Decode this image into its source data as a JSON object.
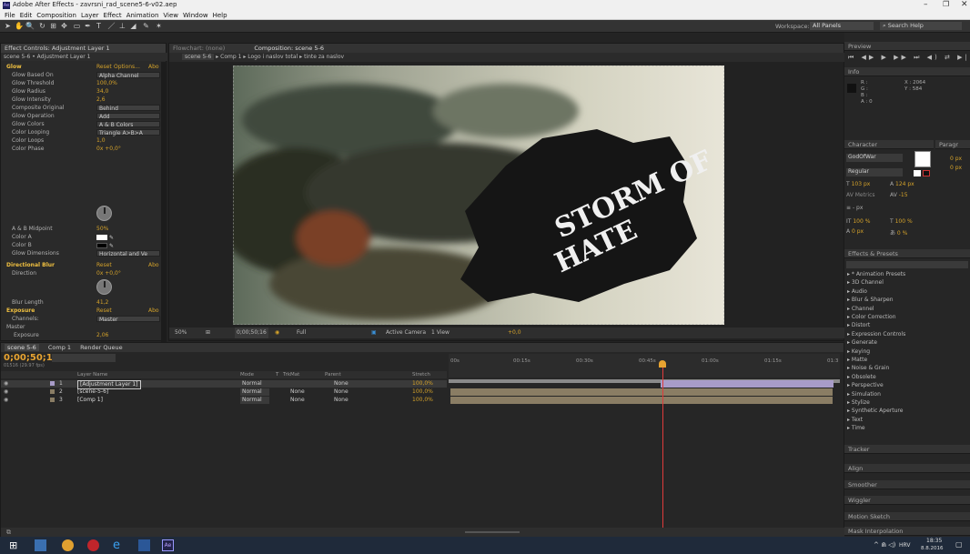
{
  "window": {
    "title": "Adobe After Effects - zavrsni_rad_scene5-6-v02.aep"
  },
  "menu": [
    "File",
    "Edit",
    "Composition",
    "Layer",
    "Effect",
    "Animation",
    "View",
    "Window",
    "Help"
  ],
  "toolbar": {
    "workspace_label": "Workspace:",
    "workspace_value": "All Panels",
    "search_placeholder": "Search Help"
  },
  "effect_controls": {
    "tab": "Effect Controls: Adjustment Layer 1",
    "breadcrumb": "scene 5-6 • Adjustment Layer 1",
    "reset": "Reset",
    "options": "Options...",
    "about": "Abo",
    "glow": {
      "name": "Glow",
      "props": [
        {
          "n": "Glow Based On",
          "dd": "Alpha Channel"
        },
        {
          "n": "Glow Threshold",
          "v": "100,0%"
        },
        {
          "n": "Glow Radius",
          "v": "34,0"
        },
        {
          "n": "Glow Intensity",
          "v": "2,6"
        },
        {
          "n": "Composite Original",
          "dd": "Behind"
        },
        {
          "n": "Glow Operation",
          "dd": "Add"
        },
        {
          "n": "Glow Colors",
          "dd": "A & B Colors"
        },
        {
          "n": "Color Looping",
          "dd": "Triangle A>B>A"
        },
        {
          "n": "Color Loops",
          "v": "1,0"
        },
        {
          "n": "Color Phase",
          "v": "0x +0,0°"
        }
      ],
      "props2": [
        {
          "n": "A & B Midpoint",
          "v": "50%"
        },
        {
          "n": "Color A",
          "v": ""
        },
        {
          "n": "Color B",
          "v": ""
        },
        {
          "n": "Glow Dimensions",
          "dd": "Horizontal and Ve"
        }
      ]
    },
    "dirblur": {
      "name": "Directional Blur",
      "props": [
        {
          "n": "Direction",
          "v": "0x +0,0°"
        },
        {
          "n": "Blur Length",
          "v": "41,2"
        }
      ]
    },
    "exposure": {
      "name": "Exposure",
      "channels_label": "Channels:",
      "channels_value": "Master",
      "master": "Master",
      "props": [
        {
          "n": "Exposure",
          "v": "2,06"
        },
        {
          "n": "Offset",
          "v": "0,0000"
        },
        {
          "n": "Gamma Correction",
          "v": "1,00"
        }
      ],
      "more": [
        "Red",
        "Green",
        "Blue"
      ]
    }
  },
  "comp_panel": {
    "tab_flowchart": "Flowchart: (none)",
    "tab_comp": "Composition: scene 5-6",
    "crumbs": [
      "scene 5-6",
      "Comp 1",
      "Logo i naslov total",
      "tinte za naslov"
    ],
    "footer": {
      "zoom": "50%",
      "time": "0;00;50;16",
      "res": "Full",
      "camera": "Active Camera",
      "view": "1 View",
      "exposure": "+0,0"
    },
    "overlay_text": [
      "STORM OF",
      "HATE"
    ]
  },
  "timeline": {
    "tabs": [
      "scene 5-6",
      "Comp 1",
      "Render Queue"
    ],
    "timecode": "0;00;50;16",
    "fps": "01516 (29.97 fps)",
    "cols": [
      "Layer Name",
      "Mode",
      "T",
      "TrkMat",
      "Parent",
      "Stretch"
    ],
    "layers": [
      {
        "num": "1",
        "name": "[Adjustment Layer 1]",
        "mode": "Normal",
        "trk": "",
        "parent": "None",
        "stretch": "100,0%"
      },
      {
        "num": "2",
        "name": "[scene-5-6]",
        "mode": "Normal",
        "trk": "None",
        "parent": "None",
        "stretch": "100,0%"
      },
      {
        "num": "3",
        "name": "[Comp 1]",
        "mode": "Normal",
        "trk": "None",
        "parent": "None",
        "stretch": "100,0%"
      }
    ],
    "ruler": [
      "00s",
      "00:15s",
      "00:30s",
      "00:45s",
      "01:00s",
      "01:15s",
      "01:3"
    ]
  },
  "right": {
    "preview": "Preview",
    "info": "Info",
    "info_vals": {
      "r": "R :",
      "g": "G :",
      "b": "B :",
      "a": "A : 0",
      "x": "X : 2064",
      "y": "Y : 584"
    },
    "character": "Character",
    "paragraph": "Paragr",
    "font": "GodOfWar",
    "style": "Regular",
    "font_size": "103 px",
    "leading": "124 px",
    "kerning": "Metrics",
    "tracking": "-15",
    "stroke": "- px",
    "vscale": "100 %",
    "hscale": "100 %",
    "baseline": "0 px",
    "tsume": "0 %",
    "para_vals": [
      "0 px",
      "0 px"
    ],
    "effects_presets": "Effects & Presets",
    "effects_list": [
      "* Animation Presets",
      "3D Channel",
      "Audio",
      "Blur & Sharpen",
      "Channel",
      "Color Correction",
      "Distort",
      "Expression Controls",
      "Generate",
      "Keying",
      "Matte",
      "Noise & Grain",
      "Obsolete",
      "Perspective",
      "Simulation",
      "Stylize",
      "Synthetic Aperture",
      "Text",
      "Time"
    ],
    "panels": [
      "Tracker",
      "Align",
      "Smoother",
      "Wiggler",
      "Motion Sketch",
      "Mask Interpolation"
    ]
  },
  "taskbar": {
    "time": "18:35",
    "date": "8.8.2016",
    "lang": "HRV"
  }
}
